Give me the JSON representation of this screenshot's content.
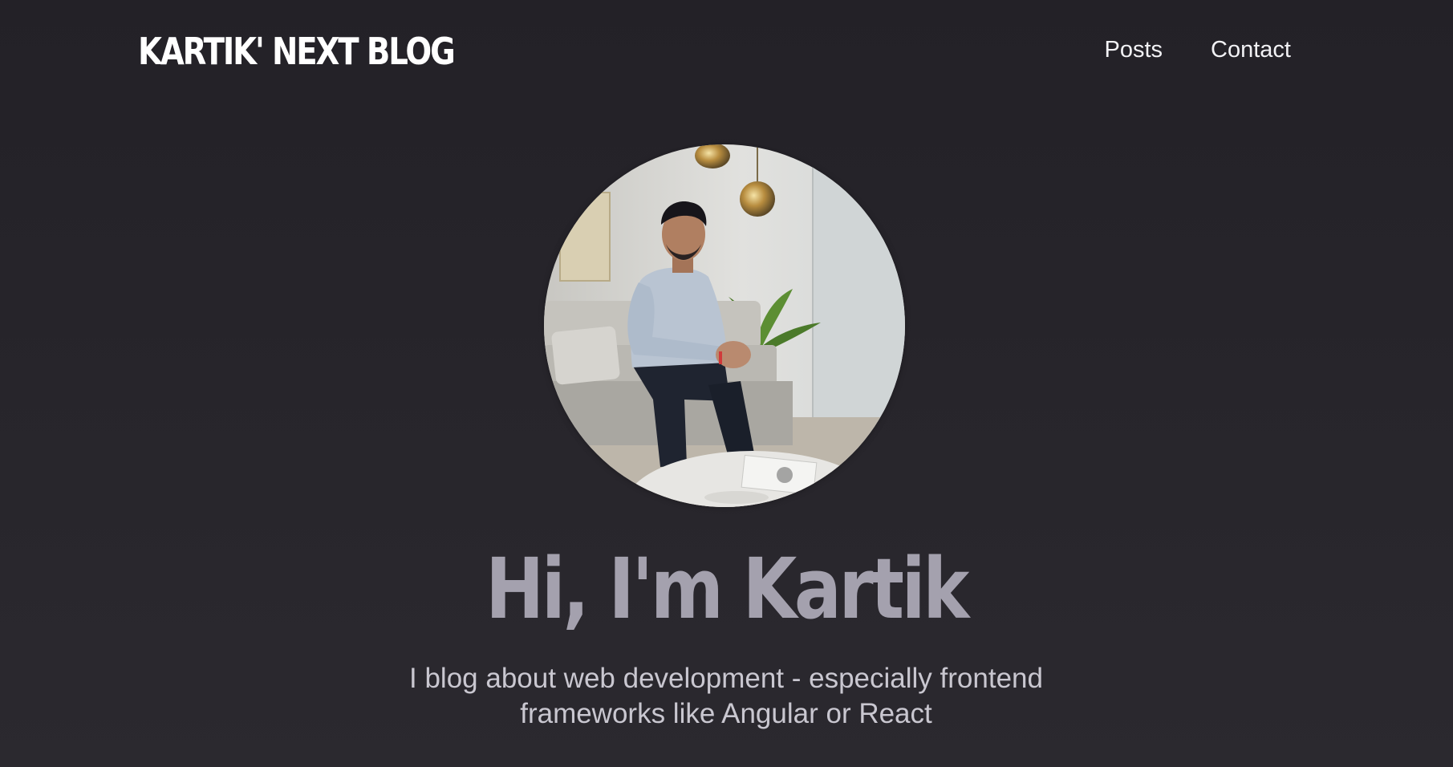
{
  "header": {
    "logo_text": "KARTIK' NEXT BLOG",
    "nav": {
      "posts_label": "Posts",
      "contact_label": "Contact"
    }
  },
  "hero": {
    "avatar_alt": "Kartik",
    "title": "Hi, I'm Kartik",
    "subtitle": "I blog about web development - especially frontend frameworks like Angular or React"
  },
  "colors": {
    "background_top": "#232127",
    "background_bottom": "#2b292f",
    "logo": "#ffffff",
    "nav_text": "#f2f2f5",
    "hero_title": "#a4a1ae",
    "hero_subtitle": "#c9c7d0"
  }
}
